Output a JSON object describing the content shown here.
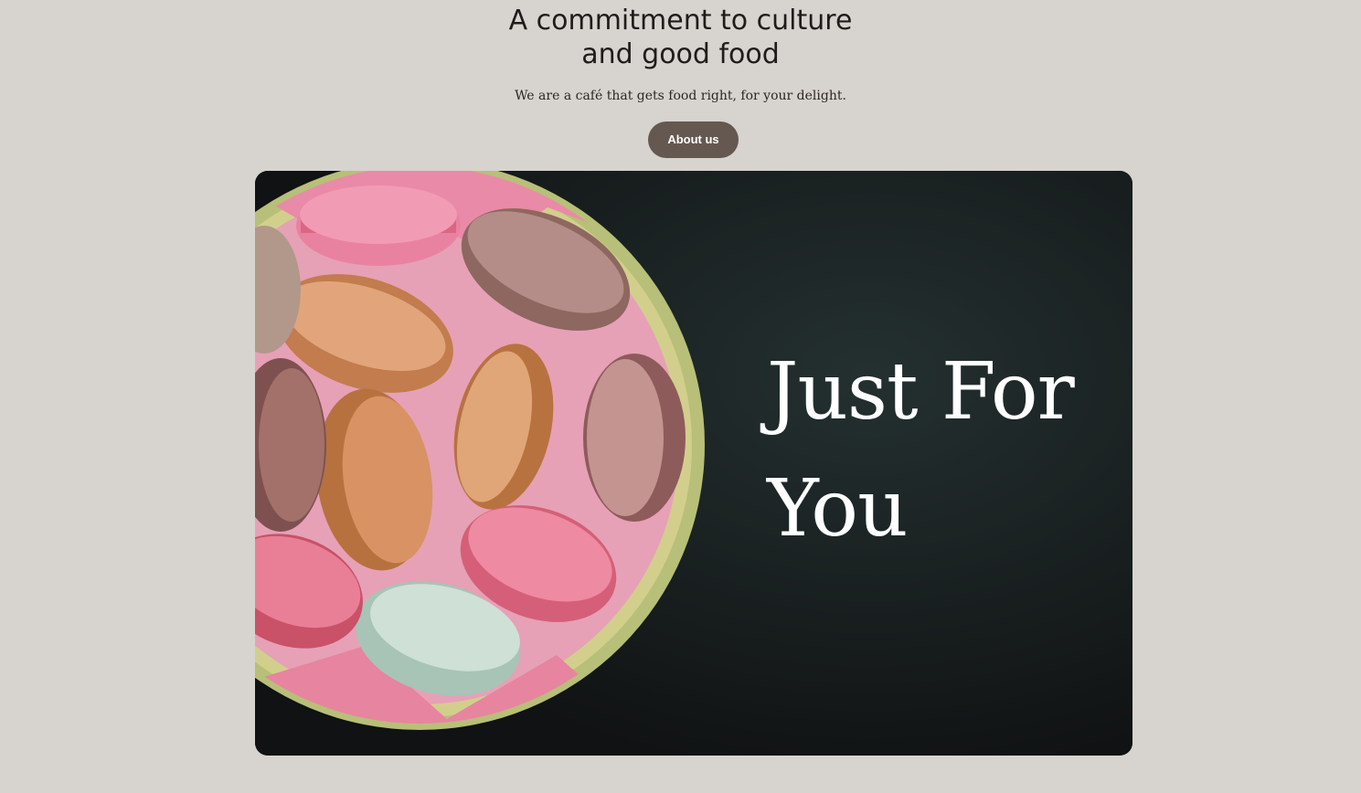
{
  "hero": {
    "heading_line1": "A commitment to culture",
    "heading_line2": "and good food",
    "tagline": "We are a café that gets food right, for your delight.",
    "button_label": "About us"
  },
  "feature": {
    "image_subject": "bowl of macarons on a dark background",
    "overlay_line1": "Just For",
    "overlay_line2": "You"
  },
  "colors": {
    "page_background": "#d7d3ce",
    "button_background": "#655851",
    "button_text": "#ffffff",
    "heading_text": "#1f1c1a",
    "image_background": "#16191a",
    "overlay_text": "#ffffff"
  }
}
